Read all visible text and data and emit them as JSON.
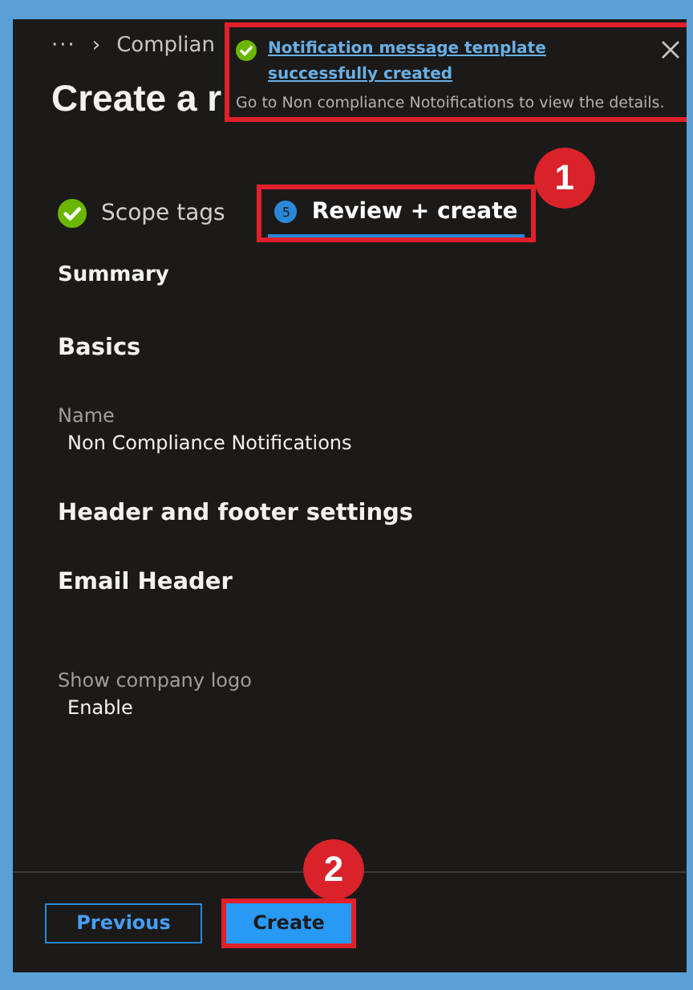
{
  "breadcrumb": {
    "more": "···",
    "separator": "›",
    "item": "Complian"
  },
  "title": "Create a r",
  "toast": {
    "title": "Notification message template successfully created",
    "message": "Go to Non compliance Notoifications to view the details."
  },
  "tabs": [
    {
      "label": "Scope tags",
      "completed": true,
      "selected": false
    },
    {
      "label": "Review + create",
      "completed": false,
      "step": "5",
      "selected": true,
      "callout": "1"
    }
  ],
  "sections": [
    {
      "kind": "subheading",
      "text": "Summary"
    },
    {
      "kind": "heading",
      "text": "Basics"
    },
    {
      "kind": "field",
      "label": "Name",
      "value": "Non Compliance Notifications"
    },
    {
      "kind": "heading",
      "text": "Header and footer settings"
    },
    {
      "kind": "heading",
      "text": "Email Header"
    },
    {
      "kind": "field",
      "label": "Show company logo",
      "value": "Enable"
    }
  ],
  "buttons": [
    {
      "label": "Previous",
      "kind": "secondary"
    },
    {
      "label": "Create",
      "kind": "primary",
      "callout": "2"
    }
  ]
}
